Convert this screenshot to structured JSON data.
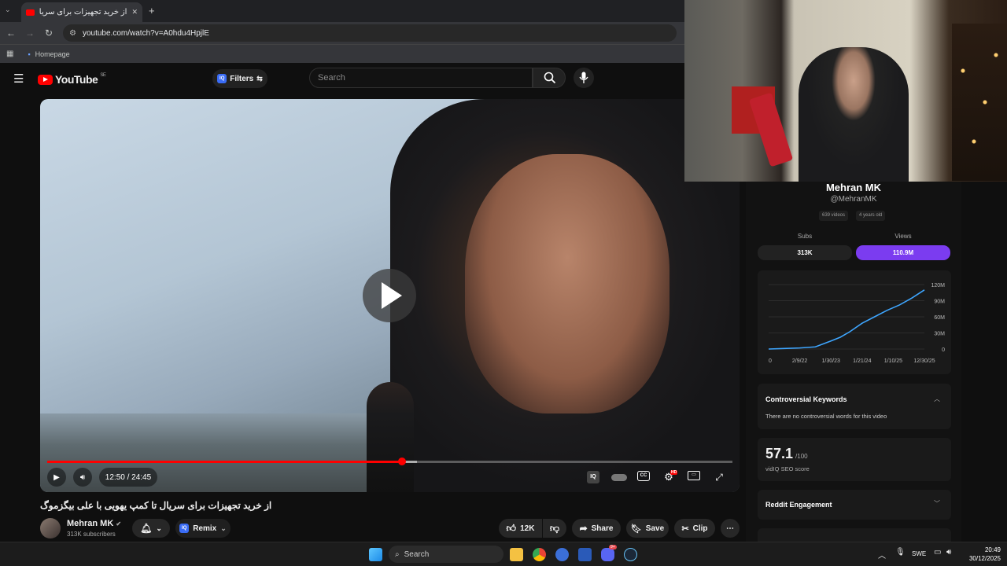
{
  "browser": {
    "tab_title": "از خرید تجهیزات برای سریال تا ک...",
    "url": "youtube.com/watch?v=A0hdu4HpjlE",
    "bookmark": "Homepage",
    "new_tab_label": "+",
    "close_tab_label": "✕"
  },
  "youtube": {
    "logo_text": "YouTube",
    "logo_region": "SE",
    "filters_label": "Filters",
    "iq_badge": "IQ",
    "search_placeholder": "Search"
  },
  "player": {
    "time_display": "12:50 / 24:45",
    "progress_fraction": 0.518,
    "buffered_fraction": 0.54,
    "hd_badge": "HD"
  },
  "video": {
    "title": "از خرید تجهیزات برای سریال تا کمپ یهویی با علی بیگزموگ",
    "channel_name": "Mehran MK",
    "subscribers": "313K subscribers",
    "remix_label": "Remix",
    "like_count": "12K",
    "share_label": "Share",
    "save_label": "Save",
    "clip_label": "Clip"
  },
  "sidebar": {
    "channel_name": "Mehran MK",
    "handle": "@MehranMK",
    "video_count_tag": "639 videos",
    "age_tag": "4 years old",
    "subs_label": "Subs",
    "subs_value": "313K",
    "views_label": "Views",
    "views_value": "110.9M",
    "views_accent": "#7b3cf0",
    "controversial_title": "Controversial Keywords",
    "controversial_text": "There are no controversial words for this video",
    "seo_score": "57.1",
    "seo_max": "/100",
    "seo_label": "vidIQ SEO score",
    "reddit_title": "Reddit Engagement"
  },
  "chart_data": {
    "type": "line",
    "x_tick_labels": [
      "0",
      "2/9/22",
      "1/30/23",
      "1/21/24",
      "1/10/25",
      "12/30/25"
    ],
    "y_tick_labels": [
      "120M",
      "90M",
      "60M",
      "30M",
      "0"
    ],
    "ylim": [
      0,
      120
    ],
    "series": [
      {
        "color": "#3ea6ff",
        "x": [
          0,
          0.5,
          1,
          1.5,
          2,
          2.3,
          2.6,
          3.0,
          3.4,
          3.8,
          4.2,
          4.6,
          5.0
        ],
        "values": [
          0,
          1,
          2,
          4,
          15,
          22,
          32,
          48,
          60,
          72,
          82,
          95,
          110
        ]
      }
    ]
  },
  "taskbar": {
    "search_label": "Search",
    "language": "SWE",
    "time": "20:49",
    "date": "30/12/2025",
    "discord_badge": "9+"
  }
}
